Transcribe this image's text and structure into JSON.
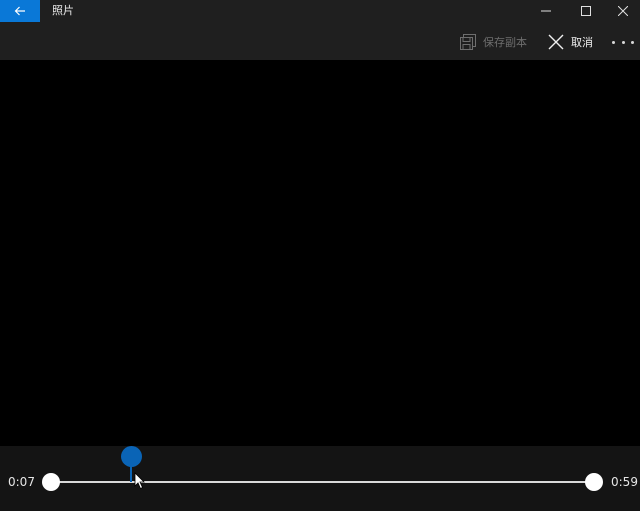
{
  "window": {
    "title": "照片",
    "accent_color": "#0a78d7"
  },
  "commandbar": {
    "save_copy_label": "保存副本",
    "cancel_label": "取消"
  },
  "trim": {
    "start_time": "0:07",
    "end_time": "0:59",
    "playhead_color": "#0a64b6"
  },
  "icons": {
    "back": "back-arrow-icon",
    "minimize": "minimize-icon",
    "maximize": "maximize-icon",
    "close": "close-icon",
    "save_copy": "save-copy-icon",
    "cancel": "cancel-x-icon",
    "more": "more-ellipsis-icon",
    "cursor": "mouse-pointer-icon"
  }
}
